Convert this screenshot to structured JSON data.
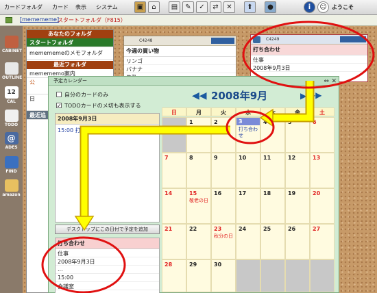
{
  "menubar": {
    "items": [
      "カードフォルダ",
      "カード",
      "表示",
      "システム"
    ],
    "welcome": "ようこそ memer"
  },
  "pathbar": {
    "folder": "[memememe]",
    "current": "スタートフォルダ（F815）"
  },
  "dock": [
    "CABINET",
    "OUTLINE",
    "CAL",
    "TODO",
    "ADES",
    "FIND",
    "amazon"
  ],
  "folders": {
    "section1": "あなたのフォルダ",
    "items1": [
      "スタートフォルダ",
      "memememeのメモフォルダ"
    ],
    "section2": "最近フォルダ",
    "items2": [
      "memememo案内",
      "公",
      "日"
    ],
    "recent": "最近追"
  },
  "cards": [
    {
      "id": "C4248",
      "title": "今週の買い物",
      "lines": [
        "リンゴ",
        "バナナ",
        "牛乳"
      ]
    },
    {
      "id": "C4249",
      "title": "打ち合わせ",
      "lines": [
        "仕事",
        "2008年9月3日"
      ]
    }
  ],
  "calendar": {
    "window_title": "予定カレンダー",
    "opt1": "自分のカードのみ",
    "opt2": "TODOカードのメ切も表示する",
    "month": "2008年9月",
    "day_headers": [
      "日",
      "月",
      "火",
      "水",
      "木",
      "金",
      "土"
    ],
    "selected_date": "2008年9月3日",
    "selected_event": "15:00 打ち合わせ",
    "add_button": "デスクトップにこの日付で予定を追加",
    "detail": {
      "title": "打ち合わせ",
      "lines": [
        "仕事",
        "2008年9月3日",
        "...",
        "15:00",
        "会議室"
      ]
    },
    "days": [
      [
        "",
        "1",
        "2",
        "3",
        "4",
        "5",
        "6"
      ],
      [
        "7",
        "8",
        "9",
        "10",
        "11",
        "12",
        "13"
      ],
      [
        "14",
        "15",
        "16",
        "17",
        "18",
        "19",
        "20"
      ],
      [
        "21",
        "22",
        "23",
        "24",
        "25",
        "26",
        "27"
      ],
      [
        "28",
        "29",
        "30",
        "",
        "",
        "",
        ""
      ]
    ],
    "notes": {
      "3": "打ち合わせ",
      "15": "敬老の日",
      "23": "秋分の日"
    }
  }
}
